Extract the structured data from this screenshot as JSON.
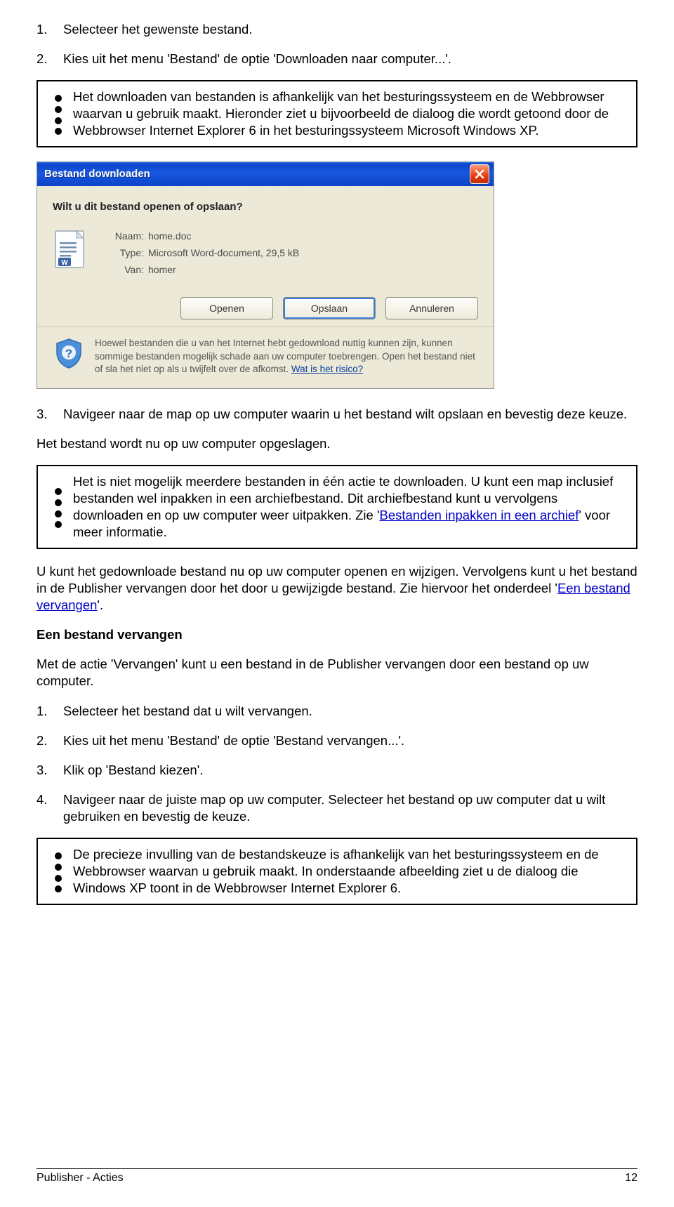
{
  "steps_a": [
    {
      "num": "1.",
      "text": "Selecteer het gewenste bestand."
    },
    {
      "num": "2.",
      "text": "Kies uit het menu 'Bestand' de optie 'Downloaden naar computer...'."
    }
  ],
  "note1": "Het downloaden van bestanden is afhankelijk van het besturingssysteem en de Webbrowser waarvan u gebruik maakt. Hieronder ziet u bijvoorbeeld de dialoog die wordt getoond door de Webbrowser Internet Explorer 6 in het besturingssysteem Microsoft Windows XP.",
  "dialog": {
    "title": "Bestand downloaden",
    "question": "Wilt u dit bestand openen of opslaan?",
    "meta": {
      "name_lbl": "Naam:",
      "name_val": "home.doc",
      "type_lbl": "Type:",
      "type_val": "Microsoft Word-document, 29,5 kB",
      "from_lbl": "Van:",
      "from_val": "homer"
    },
    "buttons": {
      "open": "Openen",
      "save": "Opslaan",
      "cancel": "Annuleren"
    },
    "warn_text": "Hoewel bestanden die u van het Internet hebt gedownload nuttig kunnen zijn, kunnen sommige bestanden mogelijk schade aan uw computer toebrengen. Open het bestand niet of sla het niet op als u twijfelt over de afkomst. ",
    "warn_link": "Wat is het risico?"
  },
  "steps_b": [
    {
      "num": "3.",
      "text": "Navigeer naar de map op uw computer waarin u het bestand wilt opslaan en bevestig deze keuze."
    }
  ],
  "after_steps_b": "Het bestand wordt nu op uw computer opgeslagen.",
  "note2_before": "Het is niet mogelijk meerdere bestanden in één actie te downloaden. U kunt een map inclusief bestanden wel inpakken in een archiefbestand. Dit archiefbestand kunt u vervolgens downloaden en op uw computer weer uitpakken. Zie '",
  "note2_link": "Bestanden inpakken in een archief",
  "note2_after": "' voor meer informatie.",
  "para_mid_before": "U kunt het gedownloade bestand nu op uw computer openen en wijzigen. Vervolgens kunt u het bestand in de Publisher vervangen door het door u gewijzigde bestand. Zie hiervoor het onderdeel '",
  "para_mid_link": "Een bestand vervangen",
  "para_mid_after": "'.",
  "heading2": "Een bestand vervangen",
  "para_h2_after": "Met de actie 'Vervangen' kunt u een bestand in de Publisher vervangen door een bestand op uw computer.",
  "steps_c": [
    {
      "num": "1.",
      "text": "Selecteer het bestand dat u wilt vervangen."
    },
    {
      "num": "2.",
      "text": "Kies uit het menu 'Bestand' de optie 'Bestand vervangen...'."
    },
    {
      "num": "3.",
      "text": "Klik op 'Bestand kiezen'."
    },
    {
      "num": "4.",
      "text": "Navigeer naar de juiste map op uw computer. Selecteer het bestand op uw computer dat u wilt gebruiken en bevestig de keuze."
    }
  ],
  "note3": "De precieze invulling van de bestandskeuze is afhankelijk van het besturingssysteem en de Webbrowser waarvan u gebruik maakt. In onderstaande afbeelding ziet u de dialoog die Windows XP toont in de Webbrowser Internet Explorer 6.",
  "footer": {
    "left": "Publisher - Acties",
    "right": "12"
  }
}
